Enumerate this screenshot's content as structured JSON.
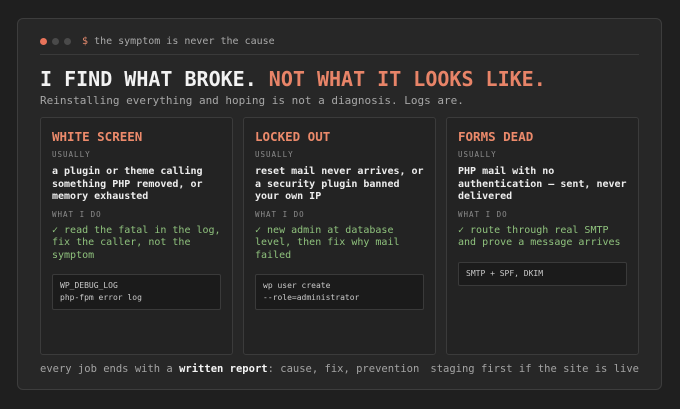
{
  "window": {
    "dots": [
      {
        "name": "window-dot-red",
        "color": "#e8735a"
      },
      {
        "name": "window-dot-gray-1",
        "color": "#4a4a4a"
      },
      {
        "name": "window-dot-gray-2",
        "color": "#4a4a4a"
      }
    ],
    "prompt_sign": "$",
    "prompt_text": "the symptom is never the cause"
  },
  "headline": {
    "part1": "I FIND WHAT BROKE.",
    "part2": "NOT WHAT IT LOOKS LIKE."
  },
  "subtitle": "Reinstalling everything and hoping is not a diagnosis. Logs are.",
  "cards": [
    {
      "title": "WHITE SCREEN",
      "usually_label": "USUALLY",
      "description": "a plugin or theme calling something PHP removed, or memory exhausted",
      "action_label": "WHAT I DO",
      "fix": "✓ read the fatal in the log, fix the caller, not the symptom",
      "code": [
        "WP_DEBUG_LOG",
        "php-fpm error log"
      ]
    },
    {
      "title": "LOCKED OUT",
      "usually_label": "USUALLY",
      "description": "reset mail never arrives, or a security plugin banned your own IP",
      "action_label": "WHAT I DO",
      "fix": "✓ new admin at database level, then fix why mail failed",
      "code": [
        "wp user create",
        "--role=administrator"
      ]
    },
    {
      "title": "FORMS DEAD",
      "usually_label": "USUALLY",
      "description": "PHP mail with no authentication — sent, never delivered",
      "action_label": "WHAT I DO",
      "fix": "✓ route through real SMTP and prove a message arrives",
      "code": [
        "SMTP + SPF, DKIM"
      ]
    }
  ],
  "footer": {
    "left_prefix": "every job ends with a",
    "left_strong": "written report",
    "left_suffix": ": cause, fix, prevention",
    "right": "staging first if the site is live"
  },
  "colors": {
    "accent": "#e88468",
    "success": "#8fc27d",
    "background": "#272727"
  }
}
